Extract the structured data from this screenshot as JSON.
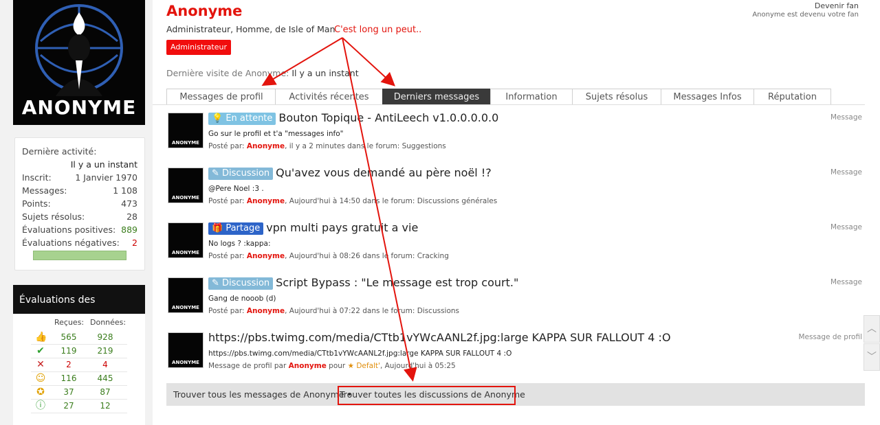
{
  "profile": {
    "avatar_caption": "ANONYME",
    "name": "Anonyme",
    "title_prefix": "Administrateur, Homme, de",
    "location": "Isle of Man",
    "role_button": "Administrateur",
    "last_visit_label": "Dernière visite de Anonyme:",
    "last_visit_value": "Il y a un instant",
    "fan_button": "Devenir fan",
    "fan_note": "Anonyme est devenu votre fan"
  },
  "annotation": "C'est long un peut..",
  "stats": {
    "last_activity_label": "Dernière activité:",
    "last_activity_value": "Il y a un instant",
    "rows": [
      {
        "label": "Inscrit:",
        "value": "1 Janvier 1970"
      },
      {
        "label": "Messages:",
        "value": "1 108"
      },
      {
        "label": "Points:",
        "value": "473"
      },
      {
        "label": "Sujets résolus:",
        "value": "28"
      },
      {
        "label": "Évaluations positives:",
        "value": "889"
      },
      {
        "label": "Évaluations négatives:",
        "value": "2"
      }
    ],
    "colors": {
      "positive": "#3a7d1c",
      "negative": "#cc0000"
    }
  },
  "evaluations": {
    "title": "Évaluations des messages",
    "col_received": "Reçues:",
    "col_given": "Données:",
    "rows": [
      {
        "icon": "thumbs-up-icon",
        "received": "565",
        "given": "928"
      },
      {
        "icon": "check-icon",
        "received": "119",
        "given": "219"
      },
      {
        "icon": "cross-icon",
        "received": "2",
        "given": "4"
      },
      {
        "icon": "smiley-icon",
        "received": "116",
        "given": "445"
      },
      {
        "icon": "award-icon",
        "received": "37",
        "given": "87"
      },
      {
        "icon": "info-icon",
        "received": "27",
        "given": "12"
      }
    ]
  },
  "tabs": [
    {
      "label": "Messages de profil"
    },
    {
      "label": "Activités récentes"
    },
    {
      "label": "Derniers messages",
      "active": true
    },
    {
      "label": "Information"
    },
    {
      "label": "Sujets résolus"
    },
    {
      "label": "Messages Infos"
    },
    {
      "label": "Réputation"
    }
  ],
  "messages": [
    {
      "badge": "En attente",
      "title": "Bouton Topique - AntiLeech v1.0.0.0.0.0",
      "snippet": "Go sur le profil et t'a \"messages info\"",
      "meta_prefix": "Posté par:",
      "user": "Anonyme",
      "meta_suffix": ", il y a 2 minutes dans le forum: Suggestions",
      "type": "Message"
    },
    {
      "badge": "Discussion",
      "title": "Qu'avez vous demandé au père noël !?",
      "snippet": "@Pere Noel :3 .",
      "meta_prefix": "Posté par:",
      "user": "Anonyme",
      "meta_suffix": ", Aujourd'hui à 14:50 dans le forum: Discussions générales",
      "type": "Message"
    },
    {
      "badge": "Partage",
      "title": "vpn multi pays gratuit a vie",
      "snippet": "No logs ? :kappa:",
      "meta_prefix": "Posté par:",
      "user": "Anonyme",
      "meta_suffix": ", Aujourd'hui à 08:26 dans le forum: Cracking",
      "type": "Message"
    },
    {
      "badge": "Discussion",
      "title": "Script Bypass : \"Le message est trop court.\"",
      "snippet": "Gang de nooob (d)",
      "meta_prefix": "Posté par:",
      "user": "Anonyme",
      "meta_suffix": ", Aujourd'hui à 07:22 dans le forum: Discussions",
      "type": "Message"
    },
    {
      "badge": "",
      "title": "https://pbs.twimg.com/media/CTtb1vYWcAANL2f.jpg:large KAPPA SUR FALLOUT 4 :O",
      "snippet": "https://pbs.twimg.com/media/CTtb1vYWcAANL2f.jpg:large KAPPA SUR FALLOUT 4 :O",
      "meta_prefix": "Message de profil par",
      "user": "Anonyme",
      "meta_mid": "pour",
      "target": "Defalt'",
      "meta_suffix": ", Aujourd'hui à 05:25",
      "type": "Message de profil"
    }
  ],
  "footer": {
    "all_messages": "Trouver tous les messages de Anonyme •",
    "all_threads": "Trouver toutes les discussions de Anonyme"
  }
}
